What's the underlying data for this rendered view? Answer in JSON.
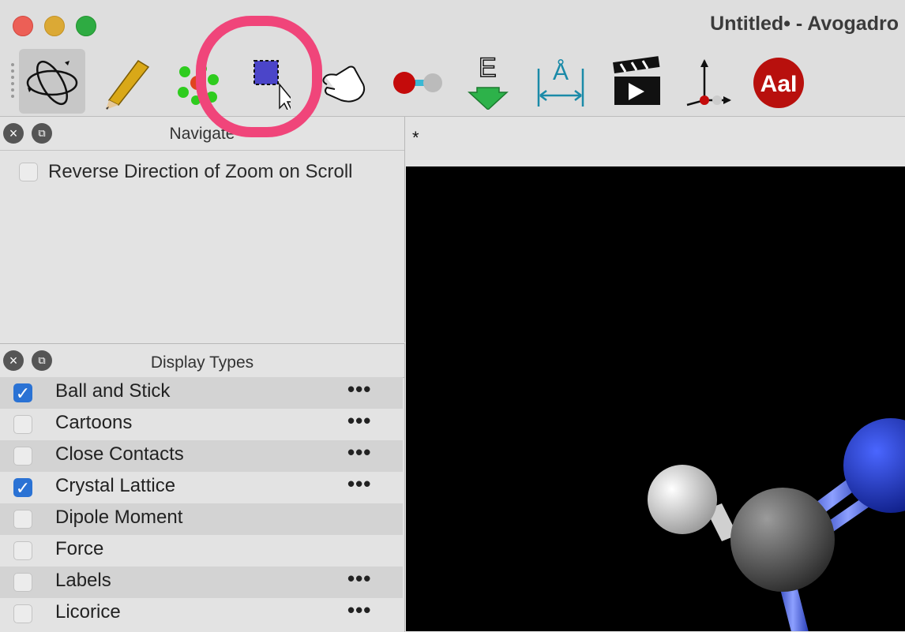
{
  "window": {
    "title": "Untitled• - Avogadro"
  },
  "toolbar": {
    "tools": [
      {
        "name": "navigate-tool",
        "icon": "orbit-icon",
        "active": true
      },
      {
        "name": "draw-tool",
        "icon": "pencil-icon"
      },
      {
        "name": "template-tool",
        "icon": "molecule-icon"
      },
      {
        "name": "selection-tool",
        "icon": "selection-icon"
      },
      {
        "name": "manipulate-tool",
        "icon": "hand-icon"
      },
      {
        "name": "bond-centric-tool",
        "icon": "bond-icon"
      },
      {
        "name": "auto-optimize-tool",
        "icon": "energy-down-icon"
      },
      {
        "name": "measure-tool",
        "icon": "angstrom-measure-icon"
      },
      {
        "name": "animation-tool",
        "icon": "clapperboard-icon"
      },
      {
        "name": "align-tool",
        "icon": "axes-icon"
      },
      {
        "name": "label-tool",
        "icon": "text-label-icon"
      }
    ],
    "highlight_color": "#f0457a"
  },
  "navigate_panel": {
    "title": "Navigate",
    "option_label": "Reverse Direction of Zoom on Scroll",
    "option_checked": false
  },
  "display_types": {
    "title": "Display Types",
    "items": [
      {
        "label": "Ball and Stick",
        "checked": true,
        "more": "•••"
      },
      {
        "label": "Cartoons",
        "checked": false,
        "more": "•••"
      },
      {
        "label": "Close Contacts",
        "checked": false,
        "more": "•••"
      },
      {
        "label": "Crystal Lattice",
        "checked": true,
        "more": "•••"
      },
      {
        "label": "Dipole Moment",
        "checked": false,
        "more": ""
      },
      {
        "label": "Force",
        "checked": false,
        "more": ""
      },
      {
        "label": "Labels",
        "checked": false,
        "more": "•••"
      },
      {
        "label": "Licorice",
        "checked": false,
        "more": "•••"
      }
    ]
  },
  "viewport": {
    "tab_label": "*"
  },
  "colors": {
    "accent": "#2a72d4",
    "atom_hydrogen": "#e0e0e0",
    "atom_carbon": "#5a5a5a",
    "atom_nitrogen": "#1b36c8"
  }
}
